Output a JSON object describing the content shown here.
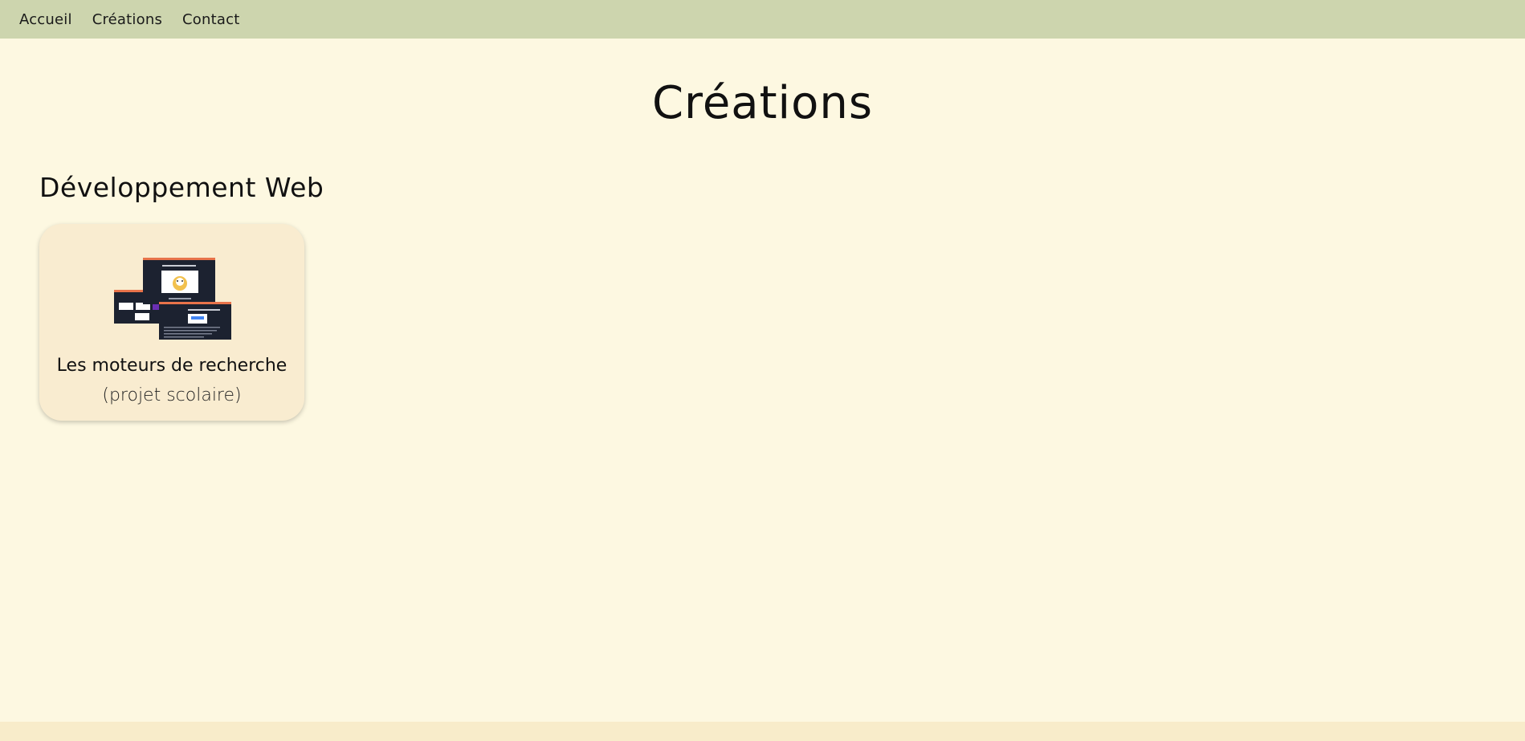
{
  "nav": {
    "items": [
      {
        "label": "Accueil"
      },
      {
        "label": "Créations"
      },
      {
        "label": "Contact"
      }
    ]
  },
  "page": {
    "title": "Créations"
  },
  "sections": [
    {
      "title": "Développement Web",
      "cards": [
        {
          "title": "Les moteurs de recherche",
          "subtitle": "(projet scolaire)",
          "thumbnail_icon": "search-engines-slides-thumbnail",
          "thumbnail_text": {
            "logo": "Google",
            "engines": [
              "Google",
              "Bing",
              "yahoo!",
              "Qwant",
              "Ecosia",
              "Opera"
            ]
          }
        }
      ]
    }
  ],
  "colors": {
    "navbar_bg": "#cdd5ae",
    "page_bg": "#fdf8e1",
    "card_bg": "#f9ecd0",
    "footer_bg": "#f8ecca",
    "slide_bg": "#1c2230",
    "slide_accent": "#e8734a"
  }
}
